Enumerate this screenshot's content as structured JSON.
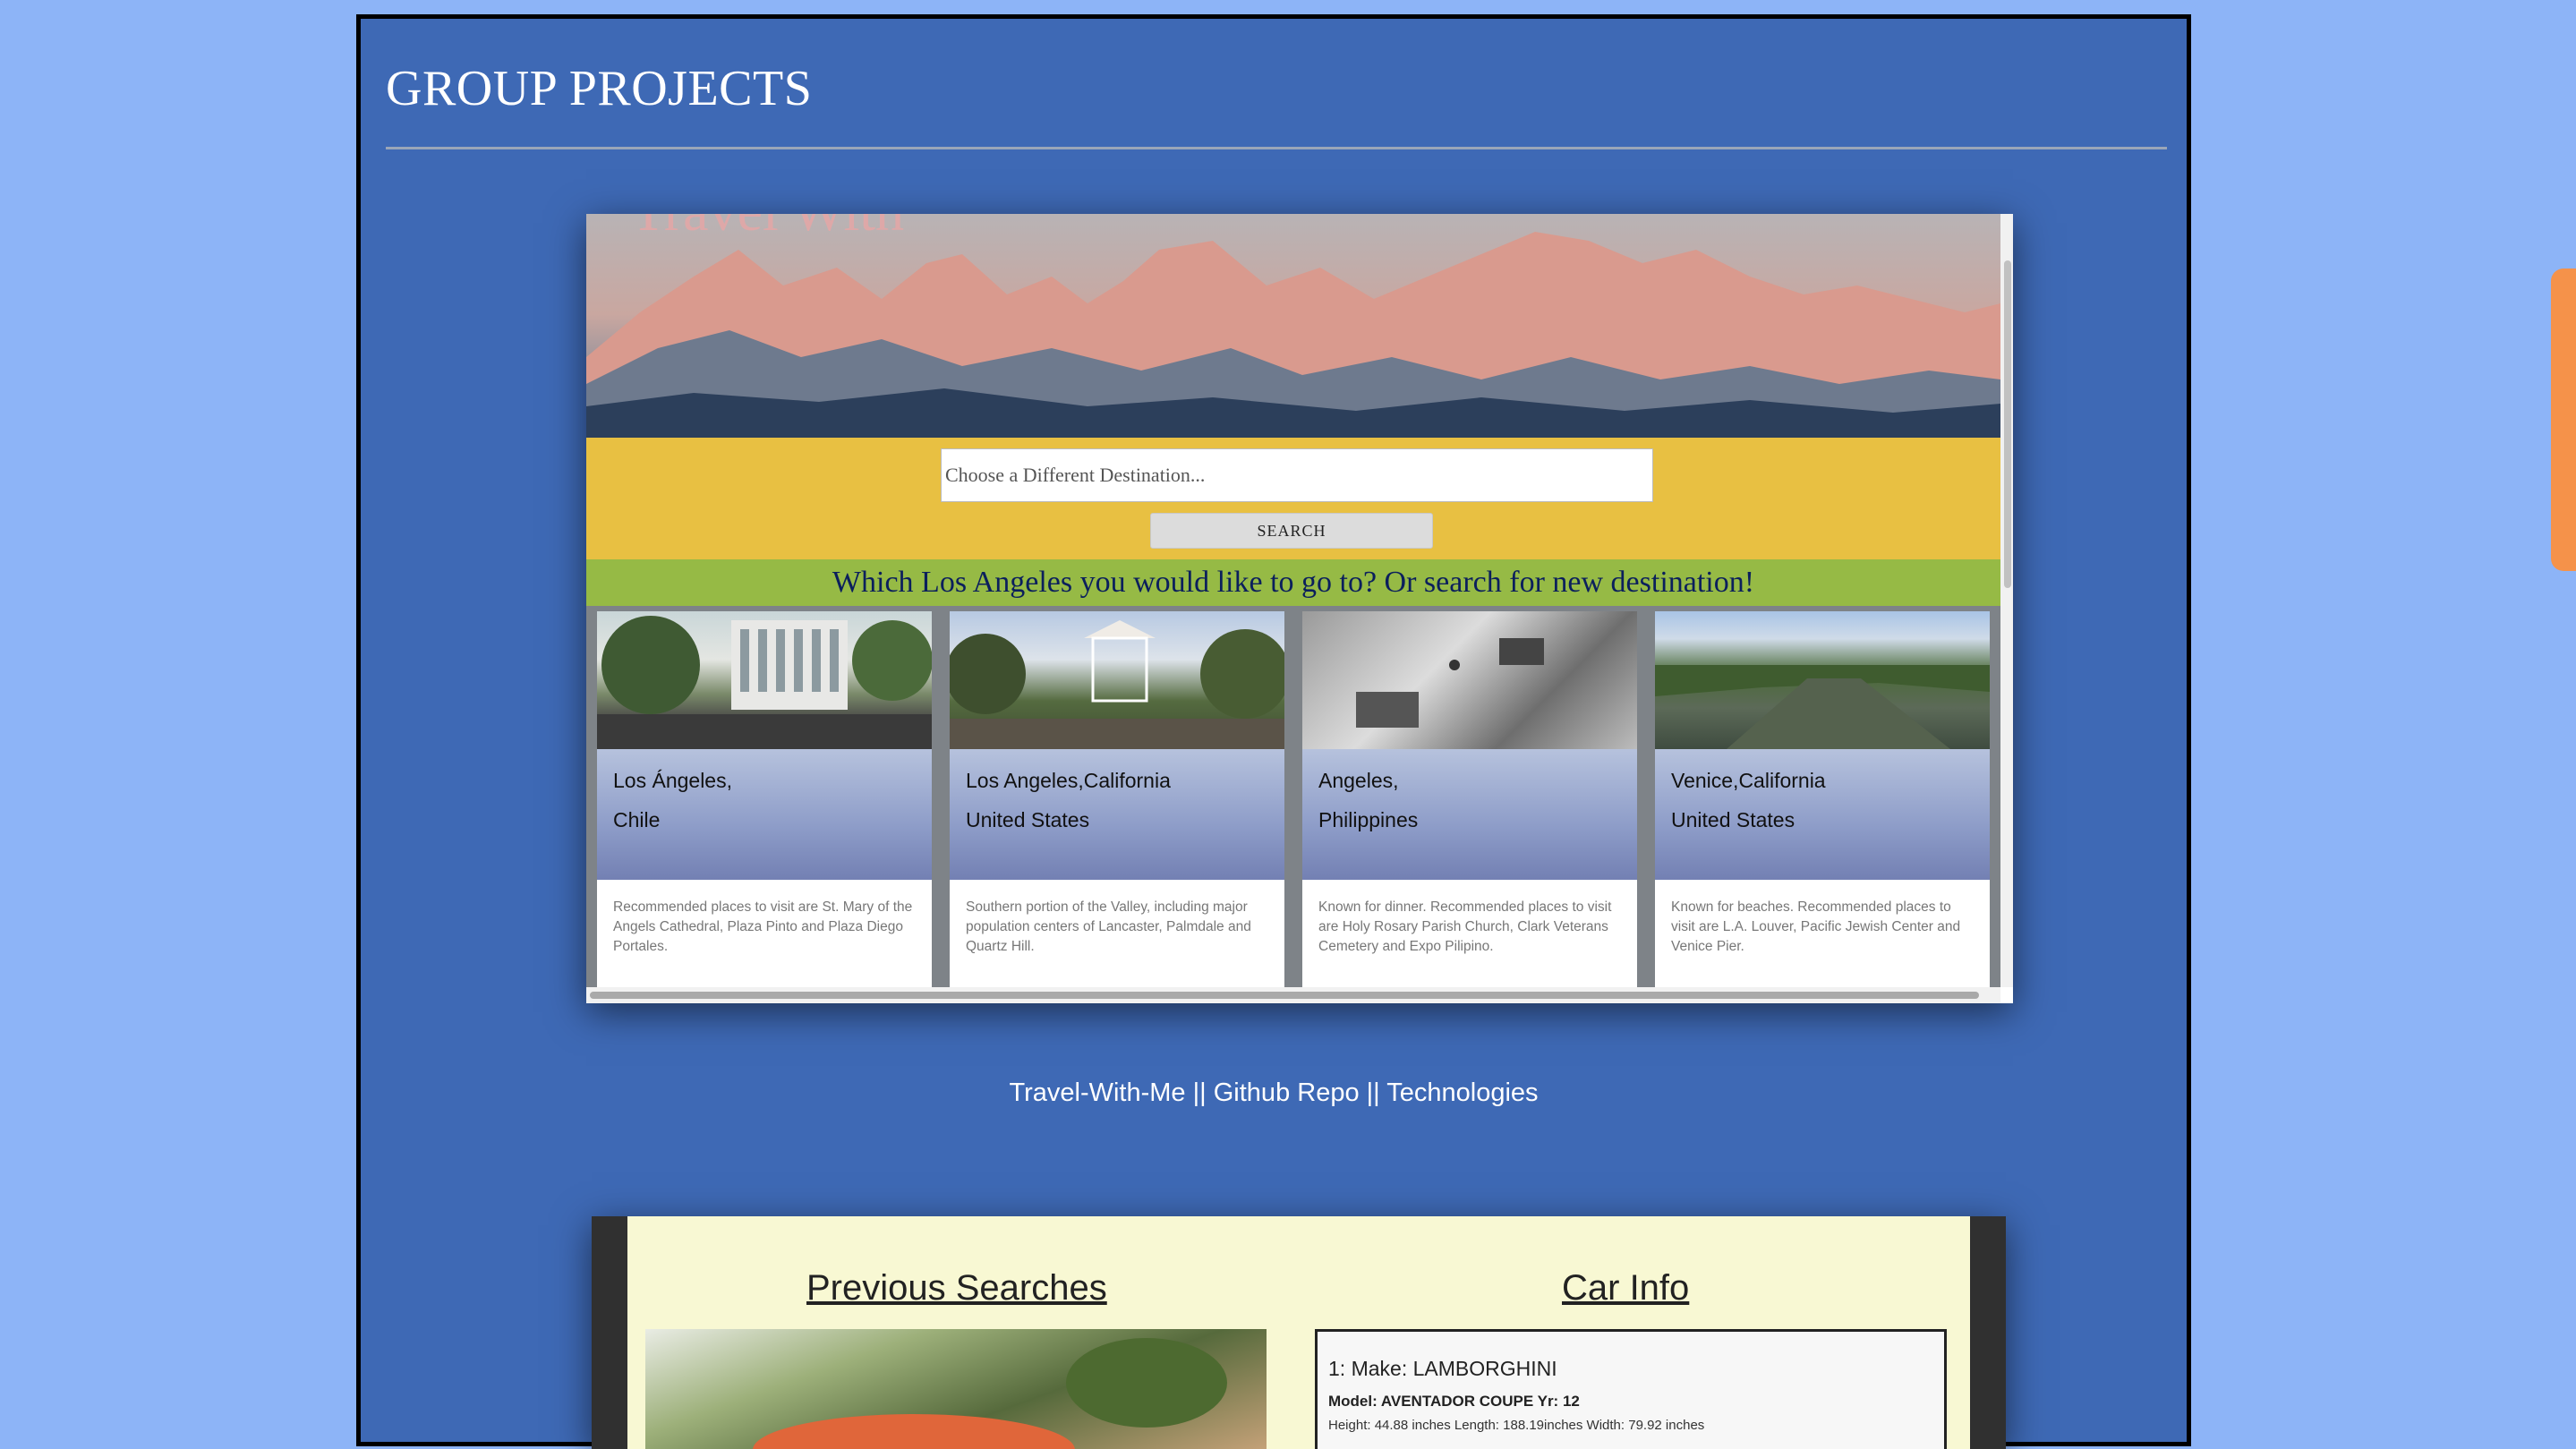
{
  "page": {
    "section_title": "GROUP PROJECTS",
    "accent_colors": {
      "page_bg": "#8db4f7",
      "panel_bg": "#3e69b5",
      "scroll_thumb": "#f5924a"
    }
  },
  "project1": {
    "search": {
      "placeholder": "Choose a Different Destination...",
      "button_label": "SEARCH"
    },
    "prompt": "Which Los Angeles you would like to go to? Or search for new destination!",
    "cards": [
      {
        "city": "Los Ángeles,",
        "country": "Chile",
        "description": "Recommended places to visit are St. Mary of the Angels Cathedral, Plaza Pinto and Plaza Diego Portales."
      },
      {
        "city": "Los Angeles,California",
        "country": "United States",
        "description": "Southern portion of the Valley, including major population centers of Lancaster, Palmdale and Quartz Hill."
      },
      {
        "city": "Angeles,",
        "country": "Philippines",
        "description": "Known for dinner. Recommended places to visit are Holy Rosary Parish Church, Clark Veterans Cemetery and Expo Pilipino."
      },
      {
        "city": "Venice,California",
        "country": "United States",
        "description": "Known for beaches. Recommended places to visit are L.A. Louver, Pacific Jewish Center and Venice Pier."
      }
    ],
    "links": {
      "site": "Travel-With-Me",
      "sep1": " || ",
      "repo": "Github Repo",
      "sep2": " || ",
      "tech": "Technologies"
    }
  },
  "project2": {
    "previous_title": "Previous Searches",
    "car_info_title": "Car Info",
    "car": {
      "make": "1: Make: LAMBORGHINI",
      "model": "Model: AVENTADOR COUPE Yr: 12",
      "dims": "Height: 44.88 inches   Length: 188.19inches   Width: 79.92 inches"
    }
  }
}
